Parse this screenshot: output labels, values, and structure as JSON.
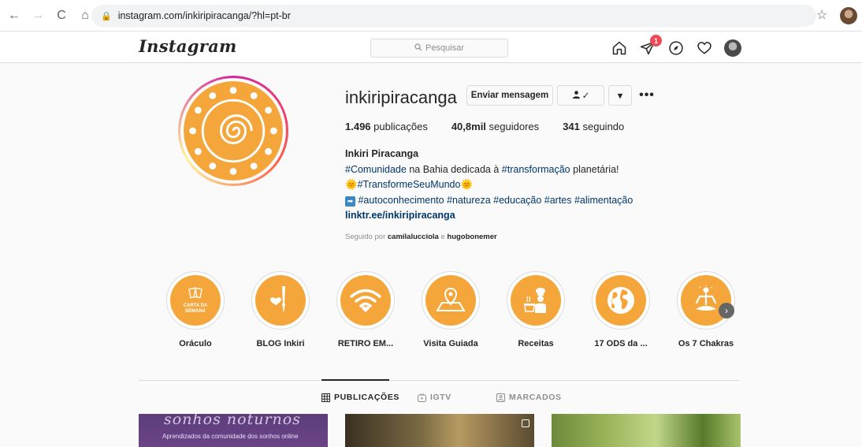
{
  "browser": {
    "url": "instagram.com/inkiripiracanga/?hl=pt-br"
  },
  "header": {
    "logo": "Instagram",
    "search_placeholder": "Pesquisar",
    "notification_count": "1"
  },
  "profile": {
    "username": "inkiripiracanga",
    "message_button": "Enviar mensagem",
    "follow_button": "✓",
    "dropdown_button": "▾",
    "more_button": "•••",
    "stats": {
      "posts_count": "1.496",
      "posts_label": "publicações",
      "followers_count": "40,8mil",
      "followers_label": "seguidores",
      "following_count": "341",
      "following_label": "seguindo"
    },
    "bio": {
      "name": "Inkiri Piracanga",
      "line1_tag1": "#Comunidade",
      "line1_text1": " na Bahia dedicada à ",
      "line1_tag2": "#transformação",
      "line1_text2": " planetária!",
      "line2_emoji_left": "🌞",
      "line2_tag": "#TransformeSeuMundo",
      "line2_emoji_right": "🌞",
      "line3_arrow": "➡",
      "line3_tags": "#autoconhecimento #natureza #educação #artes #alimentação",
      "link": "linktr.ee/inkiripiracanga"
    },
    "followed_by_prefix": "Seguido por ",
    "followed_by_user1": "camilalucciola",
    "followed_by_sep": " e ",
    "followed_by_user2": "hugobonemer"
  },
  "highlights": [
    {
      "label": "Oráculo",
      "inner_text": "CARTA DA SEMANA",
      "icon": "cards-icon"
    },
    {
      "label": "BLOG Inkiri",
      "icon": "pen-heart-icon"
    },
    {
      "label": "RETIRO EM...",
      "icon": "wifi-heart-icon"
    },
    {
      "label": "Visita Guiada",
      "icon": "map-pin-icon"
    },
    {
      "label": "Receitas",
      "icon": "chef-icon"
    },
    {
      "label": "17 ODS da ...",
      "icon": "globe-icon"
    },
    {
      "label": "Os 7 Chakras",
      "icon": "meditation-icon"
    }
  ],
  "tabs": [
    {
      "label": "PUBLICAÇÕES",
      "icon": "grid-icon"
    },
    {
      "label": "IGTV",
      "icon": "igtv-icon"
    },
    {
      "label": "MARCADOS",
      "icon": "tagged-icon"
    }
  ],
  "posts": [
    {
      "title": "sonhos noturnos",
      "subtitle": "Aprendizados da comunidade dos sonhos online"
    }
  ],
  "colors": {
    "highlight_orange": "#f4a63b",
    "link_blue": "#00376b",
    "badge_red": "#ed4956"
  }
}
